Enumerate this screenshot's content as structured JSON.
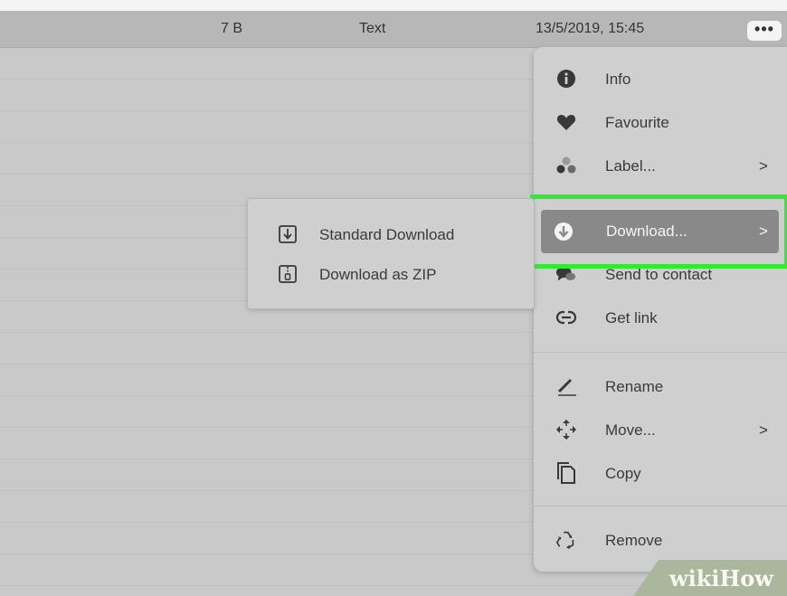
{
  "file_row": {
    "size": "7 B",
    "type": "Text",
    "modified": "13/5/2019, 15:45",
    "more_label": "•••"
  },
  "context_menu": {
    "items": [
      {
        "label": "Info",
        "icon": "info-icon"
      },
      {
        "label": "Favourite",
        "icon": "heart-icon"
      },
      {
        "label": "Label...",
        "icon": "label-dots-icon",
        "has_submenu": true
      },
      {
        "label": "Download...",
        "icon": "download-circle-icon",
        "has_submenu": true,
        "highlighted": true
      },
      {
        "label": "Send to contact",
        "icon": "chat-bubbles-icon"
      },
      {
        "label": "Get link",
        "icon": "link-icon"
      },
      {
        "label": "Rename",
        "icon": "pencil-icon"
      },
      {
        "label": "Move...",
        "icon": "move-arrows-icon",
        "has_submenu": true
      },
      {
        "label": "Copy",
        "icon": "copy-icon"
      },
      {
        "label": "Remove",
        "icon": "recycle-icon"
      }
    ],
    "chevron": ">"
  },
  "download_submenu": {
    "items": [
      {
        "label": "Standard Download",
        "icon": "download-box-icon"
      },
      {
        "label": "Download as ZIP",
        "icon": "zip-file-icon"
      }
    ]
  },
  "watermark": {
    "wiki": "wiki",
    "how": "How"
  },
  "colors": {
    "highlight_border": "#35e835",
    "selected_item_bg": "#898989",
    "menu_bg": "#cfcfcf"
  }
}
